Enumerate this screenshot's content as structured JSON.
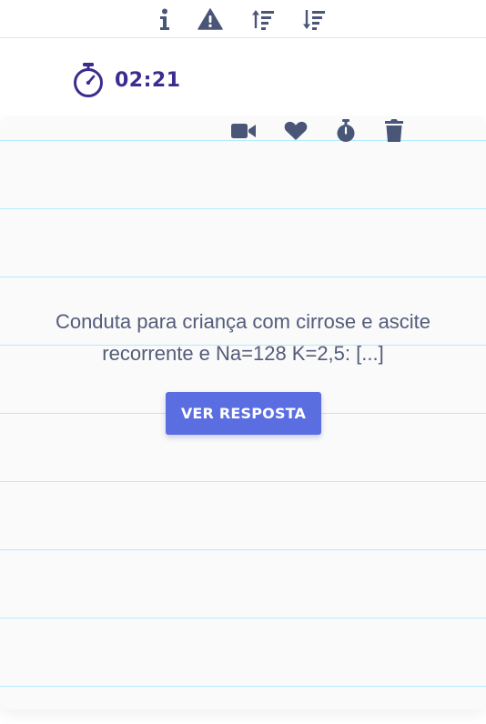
{
  "toolbar": {
    "icons": [
      "info-icon",
      "warning-icon",
      "sort-ascending-icon",
      "sort-descending-icon"
    ]
  },
  "timer": {
    "icon": "stopwatch-icon",
    "value": "02:21"
  },
  "card": {
    "actions": [
      "video-icon",
      "heart-icon",
      "stopwatch-icon",
      "trash-icon"
    ],
    "question": "Conduta para criança com cirrose e ascite recorrente e Na=128 K=2,5: [...]",
    "button_label": "VER RESPOSTA"
  },
  "colors": {
    "icon": "#4a5677",
    "timer": "#3c2c8f",
    "accent": "#5b6ee1",
    "ruled_line": "#b2ecfb",
    "question_text": "#535c7a"
  }
}
